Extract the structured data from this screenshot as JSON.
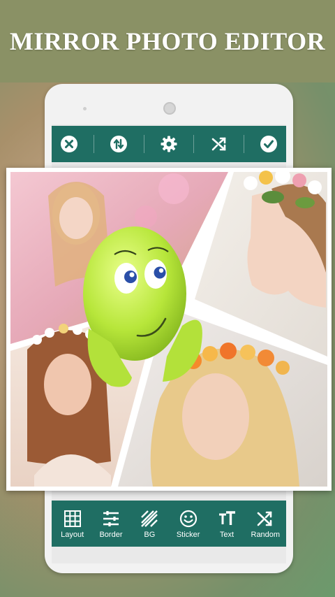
{
  "banner": {
    "title": "MIRROR PHOTO EDITOR"
  },
  "colors": {
    "accent": "#1f6e63",
    "banner": "#8a9165"
  },
  "top_toolbar": {
    "buttons": [
      {
        "icon": "close-circle-icon"
      },
      {
        "icon": "swap-icon"
      },
      {
        "icon": "gear-icon"
      },
      {
        "icon": "shuffle-icon"
      },
      {
        "icon": "check-circle-icon"
      }
    ]
  },
  "bottom_toolbar": {
    "items": [
      {
        "label": "Layout",
        "icon": "grid-icon"
      },
      {
        "label": "Border",
        "icon": "sliders-icon"
      },
      {
        "label": "BG",
        "icon": "stripes-icon"
      },
      {
        "label": "Sticker",
        "icon": "smiley-icon"
      },
      {
        "label": "Text",
        "icon": "text-icon"
      },
      {
        "label": "Random",
        "icon": "shuffle-icon"
      }
    ]
  }
}
